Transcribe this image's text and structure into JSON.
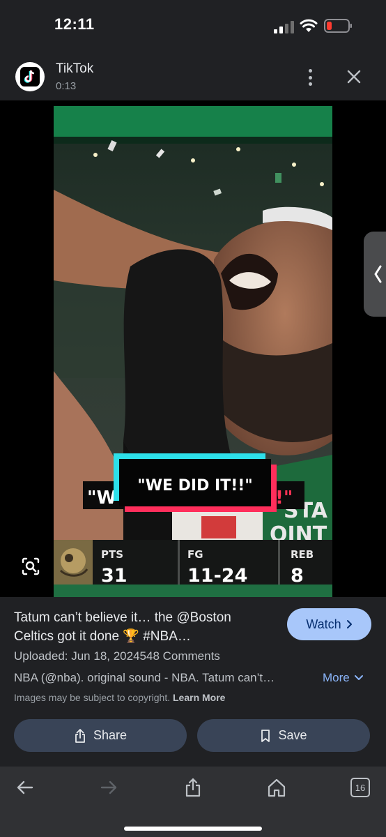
{
  "status_bar": {
    "time": "12:11"
  },
  "source": {
    "name": "TikTok",
    "duration": "0:13",
    "icons": {
      "logo": "tiktok-logo",
      "more": "more-vert-icon",
      "close": "close-icon"
    }
  },
  "video": {
    "caption": "\"WE DID IT!!\"",
    "caption_behind_left": "\"W",
    "caption_behind_right": "!\"",
    "jersey_text_1": "STA",
    "jersey_text_2": "OINT",
    "stats": [
      {
        "label": "PTS",
        "value": "31"
      },
      {
        "label": "FG",
        "value": "11-24"
      },
      {
        "label": "REB",
        "value": "8"
      }
    ]
  },
  "result": {
    "title": "Tatum can’t believe it… the @Boston Celtics got it done 🏆 #NBA…",
    "watch_label": "Watch",
    "uploaded": "Uploaded: Jun 18, 2024548 Comments",
    "description": "NBA (@nba). original sound - NBA. Tatum can’t…",
    "more_label": "More",
    "copyright": "Images may be subject to copyright.",
    "learn_more": "Learn More",
    "share_label": "Share",
    "save_label": "Save"
  },
  "toolbar": {
    "tab_count": "16"
  },
  "colors": {
    "background": "#202124",
    "accent": "#a8c7fa",
    "button_bg": "#394457",
    "link": "#8ab4f8",
    "battery_low": "#ff3b30",
    "celtics_green": "#0f7a3a"
  }
}
